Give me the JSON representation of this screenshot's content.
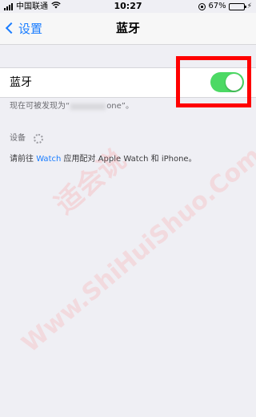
{
  "status_bar": {
    "carrier": "中国联通",
    "wifi_icon": "wifi-icon",
    "time": "10:27",
    "battery_percent": "67%",
    "battery_level": 0.67,
    "battery_color": "#ffcc00"
  },
  "nav": {
    "back_label": "设置",
    "title": "蓝牙"
  },
  "bluetooth": {
    "label": "蓝牙",
    "toggle_on": true,
    "toggle_color": "#4cd964"
  },
  "discover_prefix": "现在可被发现为“",
  "discover_suffix": "one”。",
  "devices_label": "设备",
  "pair_note": {
    "prefix": "请前往 ",
    "link": "Watch",
    "suffix": " 应用配对 Apple Watch 和 iPhone。"
  },
  "annotation": {
    "highlight_color": "#ff0000"
  },
  "watermark": {
    "cn": "适会说",
    "en": "Www.ShiHuiShuo.Com"
  }
}
